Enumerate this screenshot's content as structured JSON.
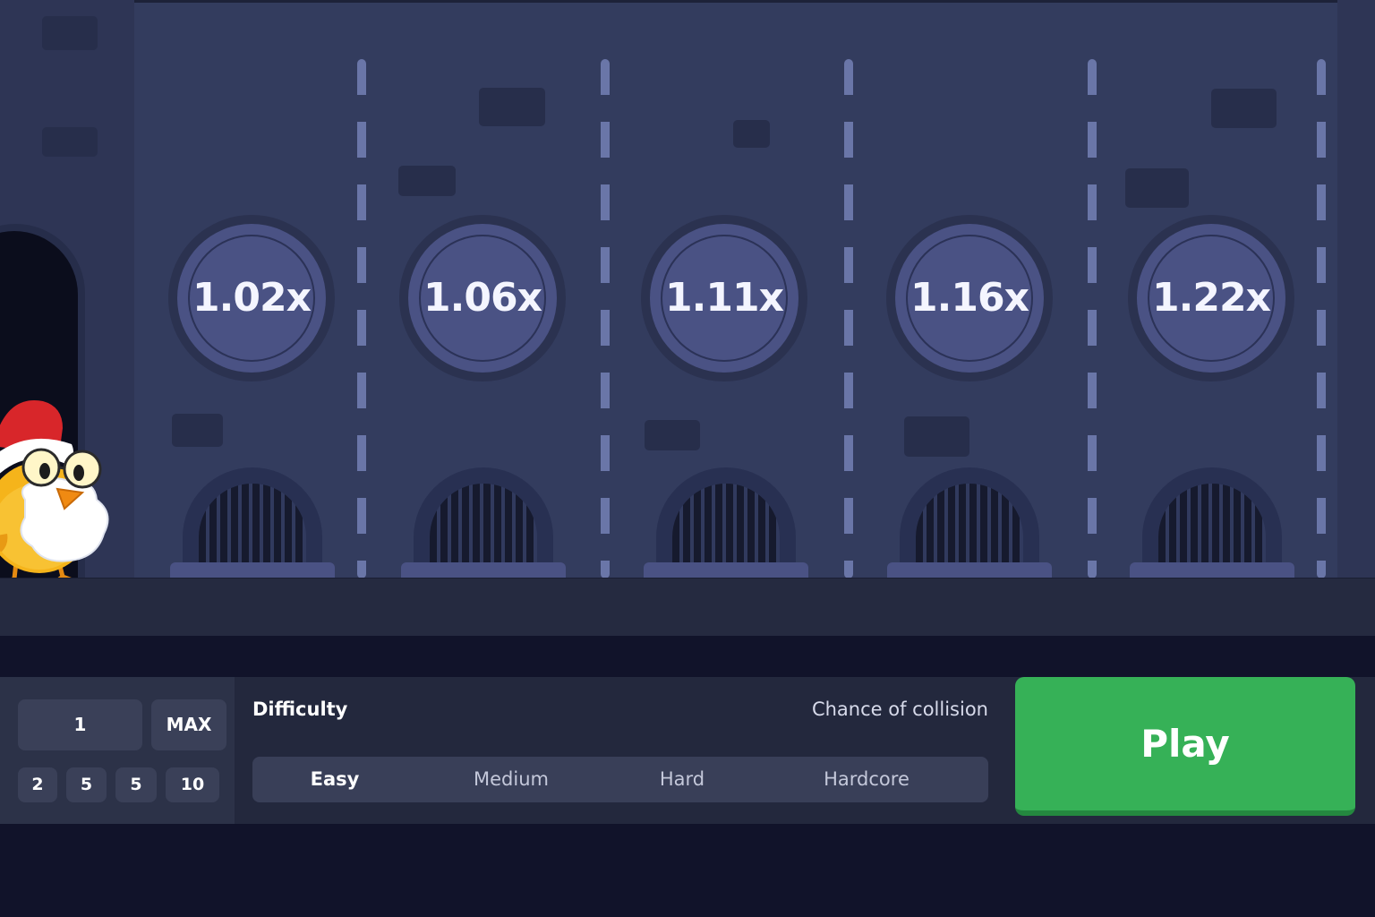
{
  "scene": {
    "multipliers": [
      "1.02x",
      "1.06x",
      "1.11x",
      "1.16x",
      "1.22x"
    ]
  },
  "bet": {
    "value": "1",
    "max_label": "MAX",
    "quick_amounts": [
      "2",
      "5",
      "5",
      "10"
    ]
  },
  "difficulty": {
    "label": "Difficulty",
    "collision_label": "Chance of collision",
    "options": [
      "Easy",
      "Medium",
      "Hard",
      "Hardcore"
    ],
    "selected": "Easy"
  },
  "play_label": "Play",
  "colors": {
    "play_green": "#36b157",
    "coin_fill": "#4a5284",
    "background": "#333c5e"
  }
}
